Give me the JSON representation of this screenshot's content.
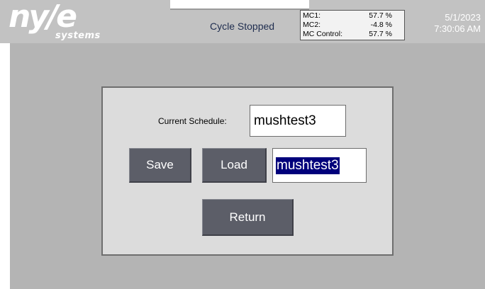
{
  "header": {
    "logo_text": "ny/e",
    "logo_subtext": "systems",
    "cycle_status": "Cycle Stopped",
    "mc_readings": [
      {
        "label": "MC1:",
        "value": "57.7 %"
      },
      {
        "label": "MC2:",
        "value": "-4.8 %"
      },
      {
        "label": "MC Control:",
        "value": "57.7 %"
      }
    ],
    "date": "5/1/2023",
    "time": "7:30:06 AM"
  },
  "schedule_panel": {
    "current_schedule_label": "Current Schedule:",
    "current_schedule_value": "mushtest3",
    "save_label": "Save",
    "load_label": "Load",
    "schedule_name_value": "mushtest3",
    "return_label": "Return"
  },
  "colors": {
    "header_bg": "#c2c2c2",
    "main_bg": "#b4b4b4",
    "panel_bg": "#dcdcdc",
    "button_bg": "#5c5e68",
    "selection_bg": "#00007b"
  }
}
